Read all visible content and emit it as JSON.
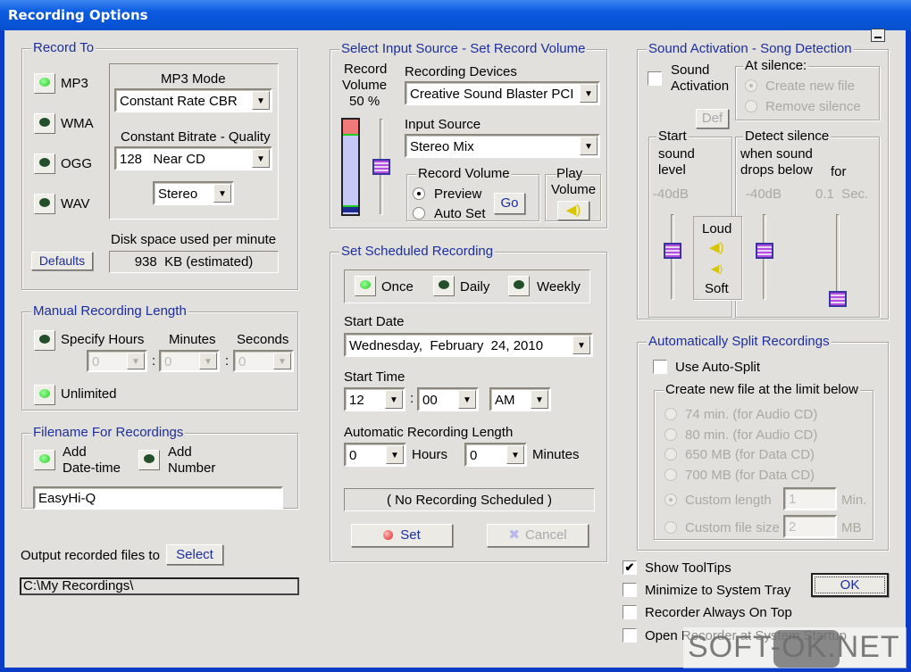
{
  "window": {
    "title": "Recording Options",
    "minimize_icon": "minimize-icon"
  },
  "record_to": {
    "legend": "Record To",
    "formats": [
      {
        "label": "MP3",
        "on": true
      },
      {
        "label": "WMA",
        "on": false
      },
      {
        "label": "OGG",
        "on": false
      },
      {
        "label": "WAV",
        "on": false
      }
    ],
    "mp3_mode_label": "MP3 Mode",
    "mp3_mode": "Constant Rate CBR",
    "bitrate_label": "Constant Bitrate - Quality",
    "bitrate": "128   Near CD",
    "channels": "Stereo",
    "disk_label": "Disk space used per minute",
    "disk_value": "938  KB (estimated)",
    "defaults": "Defaults"
  },
  "manual": {
    "legend": "Manual Recording Length",
    "specify": "Specify Hours",
    "minutes": "Minutes",
    "seconds": "Seconds",
    "h": "0",
    "m": "0",
    "s": "0",
    "sep": ":",
    "unlimited": "Unlimited",
    "specify_on": false,
    "unlimited_on": true
  },
  "filename": {
    "legend": "Filename For Recordings",
    "add_dt": "Add",
    "add_dt2": "Date-time",
    "add_num": "Add",
    "add_num2": "Number",
    "value": "EasyHi-Q"
  },
  "output": {
    "label": "Output recorded files to",
    "select": "Select",
    "path": "C:\\My Recordings\\"
  },
  "input": {
    "legend": "Select Input Source - Set Record Volume",
    "rv1": "Record",
    "rv2": "Volume",
    "rv3": "50 %",
    "volume_percent": 50,
    "devices_label": "Recording Devices",
    "device": "Creative Sound Blaster PCI",
    "source_label": "Input Source",
    "source": "Stereo Mix",
    "recvol_legend": "Record Volume",
    "preview": "Preview",
    "autoset": "Auto Set",
    "go": "Go",
    "play1": "Play",
    "play2": "Volume"
  },
  "schedule": {
    "legend": "Set Scheduled Recording",
    "once": "Once",
    "daily": "Daily",
    "weekly": "Weekly",
    "start_date_label": "Start Date",
    "start_date": "Wednesday,  February  24, 2010",
    "start_time_label": "Start Time",
    "hour": "12",
    "minute": "00",
    "ampm": "AM",
    "sep": ":",
    "auto_label": "Automatic Recording Length",
    "auto_h": "0",
    "hours": "Hours",
    "auto_m": "0",
    "minutes": "Minutes",
    "status": "( No Recording Scheduled )",
    "set": "Set",
    "cancel": "Cancel"
  },
  "sound": {
    "legend": "Sound Activation - Song Detection",
    "sa1": "Sound",
    "sa2": "Activation",
    "at_silence": "At silence:",
    "create": "Create new file",
    "remove": "Remove silence",
    "def": "Def",
    "start": "Start",
    "sound_w": "sound",
    "level": "level",
    "start_db": "-40dB",
    "loud": "Loud",
    "soft": "Soft",
    "detect": "Detect silence",
    "when": "when sound",
    "drops": "drops below",
    "for": "for",
    "detect_db": "-40dB",
    "secs": "0.1  Sec."
  },
  "split": {
    "legend": "Automatically Split Recordings",
    "use": "Use Auto-Split",
    "inner": "Create new file at the limit below",
    "options": [
      "74 min. (for Audio CD)",
      "80 min. (for Audio CD)",
      "650 MB (for Data CD)",
      "700 MB (for Data CD)",
      "Custom length",
      "Custom file size"
    ],
    "len": "1",
    "len_unit": "Min.",
    "size": "2",
    "size_unit": "MB"
  },
  "options": [
    {
      "label": "Show ToolTips",
      "checked": true
    },
    {
      "label": "Minimize to System Tray",
      "checked": false
    },
    {
      "label": "Recorder Always On Top",
      "checked": false
    },
    {
      "label": "Open Recorder at System Startup",
      "checked": false
    }
  ],
  "ok": "OK",
  "watermark": "SOFT-OK.NET",
  "colors": {
    "title_bar": "#0a5ae0",
    "legend": "#1d2ea0",
    "led_on": "#33cc33"
  }
}
